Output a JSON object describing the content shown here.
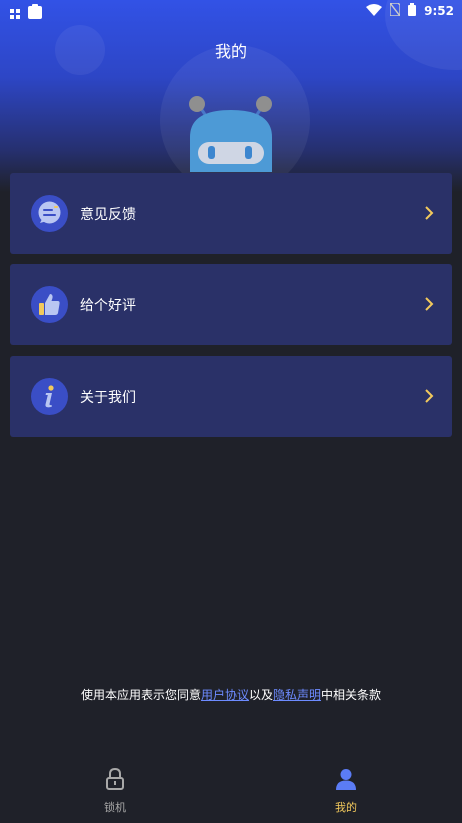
{
  "status_bar": {
    "time": "9:52"
  },
  "header": {
    "title": "我的"
  },
  "menu": {
    "items": [
      {
        "label": "意见反馈",
        "icon": "feedback-chat-icon"
      },
      {
        "label": "给个好评",
        "icon": "thumbs-up-icon"
      },
      {
        "label": "关于我们",
        "icon": "info-icon"
      }
    ]
  },
  "agreement": {
    "prefix": "使用本应用表示您同意",
    "link1": "用户协议",
    "middle": "以及",
    "link2": "隐私声明",
    "suffix": "中相关条款"
  },
  "tabs": [
    {
      "label": "锁机",
      "icon": "lock-icon",
      "active": false
    },
    {
      "label": "我的",
      "icon": "user-icon",
      "active": true
    }
  ],
  "colors": {
    "background": "#1f2129",
    "header_blue": "#3252e6",
    "card": "#2a3168",
    "accent_link": "#6d8bff",
    "active_tab": "#f2c95c",
    "chevron": "#f2c95c"
  }
}
